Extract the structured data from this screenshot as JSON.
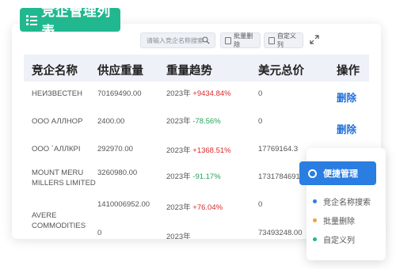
{
  "title": "竞企管理列表",
  "toolbar": {
    "search_placeholder": "请输入竞企名称搜索",
    "batch_delete": "批量删除",
    "custom_columns": "自定义列"
  },
  "columns": [
    "竞企名称",
    "供应重量",
    "重量趋势",
    "美元总价",
    "操作"
  ],
  "rows": [
    {
      "name": "НЕИЗВЕСТЕН",
      "weight": "70169490.00",
      "year": "2023年",
      "trend": "+9434.84%",
      "total": "0",
      "action": "删除"
    },
    {
      "name": "ООО АЛЛНОР",
      "weight": "2400.00",
      "year": "2023年",
      "trend": "-78.56%",
      "total": "0",
      "action": "删除"
    },
    {
      "name": "ООО `АЛЛКРІ",
      "weight": "292970.00",
      "year": "2023年",
      "trend": "+1368.51%",
      "total": "17769164.3"
    },
    {
      "name": "MOUNT MERU MILLERS LIMITED",
      "weight": "3260980.00",
      "year": "2023年",
      "trend": "-91.17%",
      "total": "1731784691"
    },
    {
      "name": "AVERE COMMODITIES",
      "weight": "1410006952.00",
      "year": "2023年",
      "trend": "+76.04%",
      "total": "0"
    },
    {
      "name": "",
      "weight": "0",
      "year": "2023年",
      "trend": "",
      "total": "73493248.00"
    }
  ],
  "quick_panel": {
    "button": "便捷管理",
    "items": [
      {
        "label": "竞企名称搜索",
        "color": "#2a7de1"
      },
      {
        "label": "批量删除",
        "color": "#f0a040"
      },
      {
        "label": "自定义列",
        "color": "#21b890"
      }
    ]
  }
}
